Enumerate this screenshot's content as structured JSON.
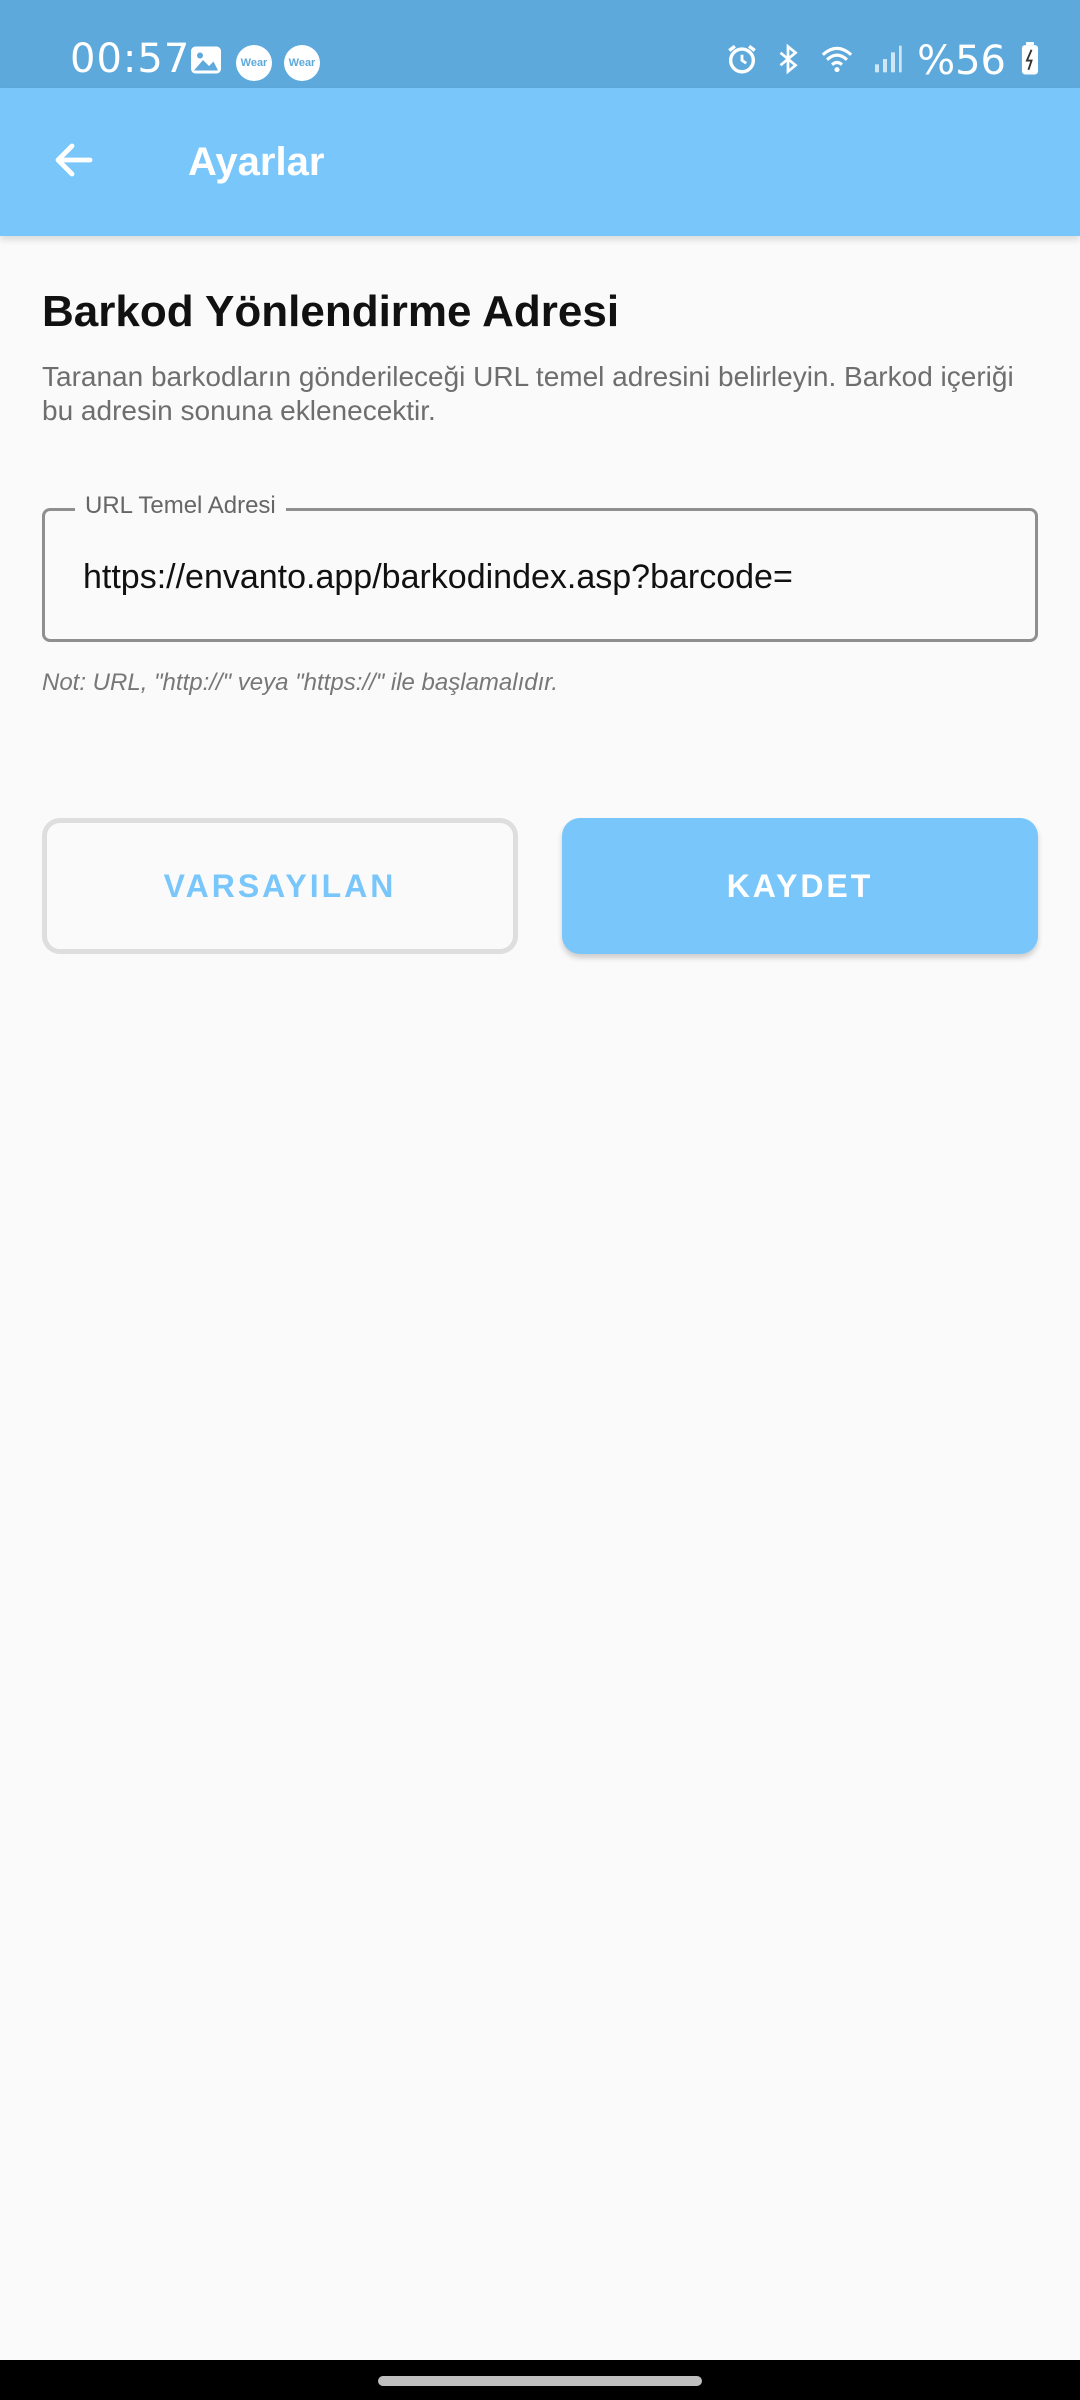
{
  "status_bar": {
    "time": "00:57",
    "left_icons": [
      "image-icon",
      "wear-icon",
      "wear-icon"
    ],
    "wear_label": "Wear",
    "right_icons": [
      "alarm-icon",
      "bluetooth-icon",
      "wifi-icon",
      "signal-icon",
      "battery-icon"
    ],
    "battery": "%56"
  },
  "app_bar": {
    "title": "Ayarlar",
    "back_icon": "arrow-left-icon"
  },
  "section": {
    "title": "Barkod Yönlendirme Adresi",
    "description": "Taranan barkodların gönderileceği URL temel adresini belirleyin. Barkod içeriği bu adresin sonuna eklenecektir."
  },
  "url_field": {
    "label": "URL Temel Adresi",
    "value": "https://envanto.app/barkodindex.asp?barcode="
  },
  "note": "Not: URL, \"http://\" veya \"https://\" ile başlamalıdır.",
  "buttons": {
    "default_label": "VARSAYILAN",
    "save_label": "KAYDET"
  },
  "colors": {
    "status_bar": "#5da9dc",
    "accent": "#79c6fb",
    "background": "#fafafa"
  }
}
